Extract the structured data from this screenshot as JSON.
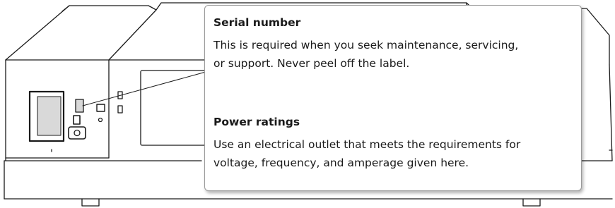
{
  "callout": {
    "serial": {
      "title": "Serial number",
      "lines": [
        "This is required when you seek maintenance, servicing,",
        "or support. Never peel off the label."
      ]
    },
    "power": {
      "title": "Power ratings",
      "lines": [
        "Use an electrical outlet that meets the requirements for",
        "voltage, frequency, and amperage given here."
      ]
    }
  },
  "colors": {
    "outline": "#1a1a1a",
    "callout_border": "#9a9a9a",
    "label_fill": "#d9d9d9",
    "background": "#ffffff"
  }
}
